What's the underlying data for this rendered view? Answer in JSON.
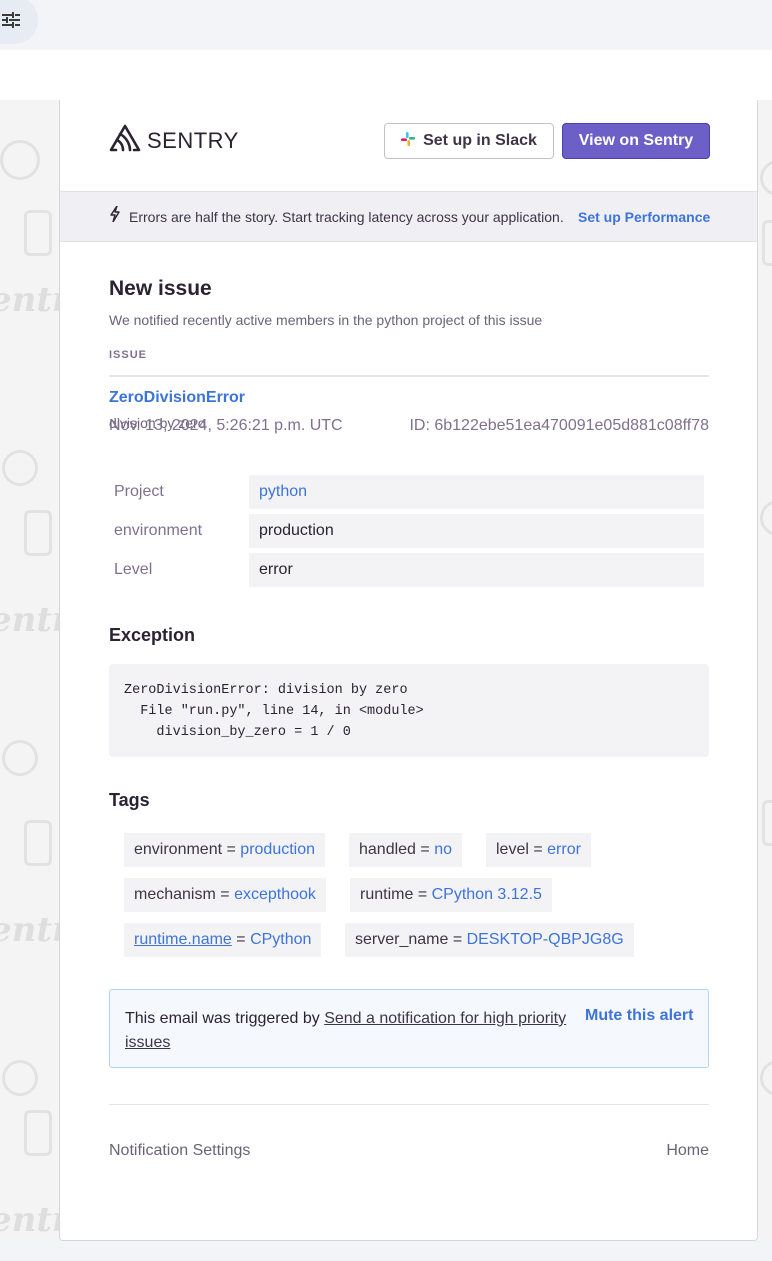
{
  "toolbar": {
    "filter_icon": "sliders-icon"
  },
  "header": {
    "brand": "SENTRY",
    "slack_button": "Set up in Slack",
    "view_button": "View on Sentry",
    "brand_color": "#6c5fc7"
  },
  "banner": {
    "icon": "lightning-icon",
    "message": "Errors are half the story. Start tracking latency across your application.",
    "link": "Set up Performance"
  },
  "issue": {
    "heading": "New issue",
    "subheading": "We notified recently active members in the python project of this issue",
    "section_label": "ISSUE",
    "title": "ZeroDivisionError",
    "subtitle": "division by zero",
    "datetime": "Nov. 13, 2024, 5:26:21 p.m. UTC",
    "id": "ID: 6b122ebe51ea470091e05d881c08ff78"
  },
  "details": [
    {
      "key": "Project",
      "value": "python"
    },
    {
      "key": "environment",
      "value": "production"
    },
    {
      "key": "Level",
      "value": "error"
    }
  ],
  "exception": {
    "heading": "Exception",
    "trace": "ZeroDivisionError: division by zero\n  File \"run.py\", line 14, in <module>\n    division_by_zero = 1 / 0"
  },
  "tags": {
    "heading": "Tags",
    "items": [
      {
        "key": "environment",
        "value": "production"
      },
      {
        "key": "handled",
        "value": "no"
      },
      {
        "key": "level",
        "value": "error"
      },
      {
        "key": "mechanism",
        "value": "excepthook"
      },
      {
        "key": "runtime",
        "value": "CPython 3.12.5"
      },
      {
        "key": "runtime.name",
        "value": "CPython"
      },
      {
        "key": "server_name",
        "value": "DESKTOP-QBPJG8G"
      }
    ],
    "separator": "="
  },
  "notice": {
    "prefix": "This email was triggered by",
    "rule_link": "Send a notification for high priority issues",
    "mute": "Mute this alert"
  },
  "footer": {
    "left": "Notification Settings",
    "right": "Home"
  },
  "colors": {
    "link": "#3d74db",
    "text": "#2b2233",
    "muted": "#80708f"
  }
}
